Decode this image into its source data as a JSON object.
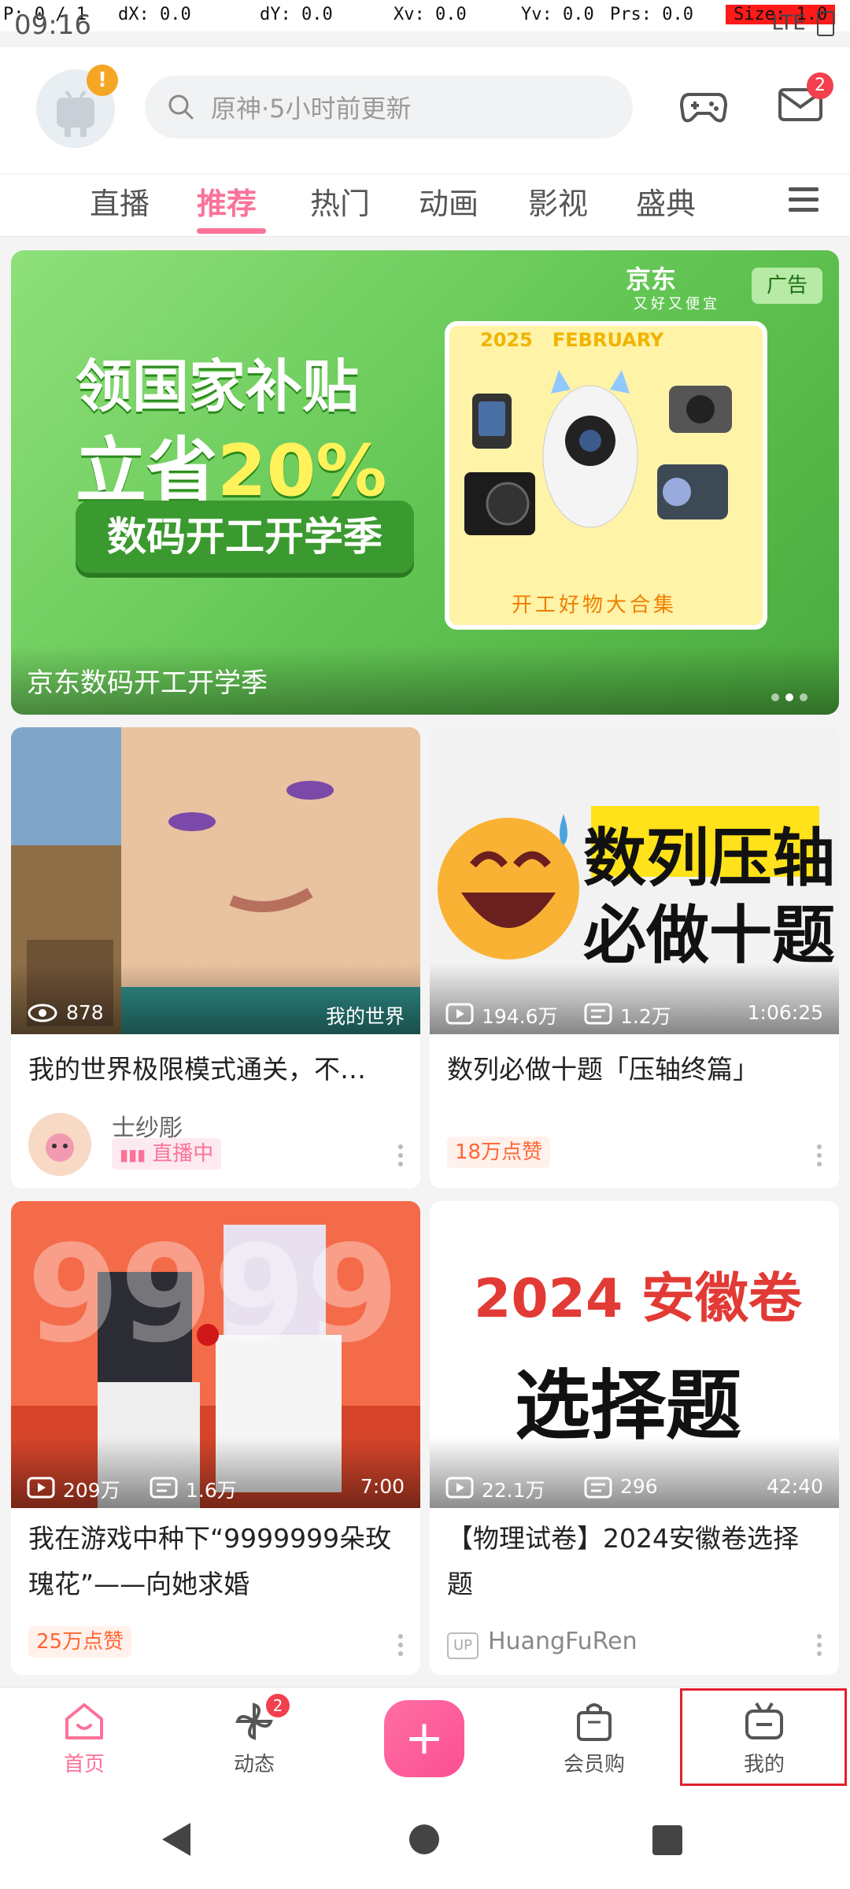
{
  "debug": {
    "pointer": "P: 0 / 1",
    "dx": "dX: 0.0",
    "dy": "dY: 0.0",
    "xv": "Xv: 0.0",
    "yv": "Yv: 0.0",
    "prs": "Prs: 0.0",
    "size": "Size: 1.0"
  },
  "status_bar": {
    "time": "09:16",
    "network": "LTE"
  },
  "header": {
    "search_placeholder": "原神·5小时前更新",
    "avatar_alert": "!",
    "mail_badge": "2"
  },
  "tabs": [
    {
      "label": "直播",
      "active": false
    },
    {
      "label": "推荐",
      "active": true
    },
    {
      "label": "热门",
      "active": false
    },
    {
      "label": "动画",
      "active": false
    },
    {
      "label": "影视",
      "active": false
    },
    {
      "label": "盛典",
      "active": false
    }
  ],
  "banner": {
    "brand": "京东",
    "brand_sub": "又好又便宜",
    "ad_label": "广告",
    "headline1": "领国家补贴",
    "headline2_prefix": "立省",
    "headline2_accent": "20%",
    "pill": "数码开工开学季",
    "box_year": "2025",
    "box_month": "FEBRUARY",
    "box_footer": "开工好物大合集",
    "caption": "京东数码开工开学季",
    "dots": 3,
    "active_dot": 1
  },
  "cards": [
    {
      "views": "878",
      "tag": "我的世界",
      "title": "我的世界极限模式通关，不…",
      "author": "士纱彫",
      "live_label": "直播中"
    },
    {
      "views": "194.6万",
      "danmaku": "1.2万",
      "duration": "1:06:25",
      "thumb_line1": "数列压轴",
      "thumb_line2": "必做十题",
      "title": "数列必做十题「压轴终篇」",
      "badge": "18万点赞"
    },
    {
      "views": "209万",
      "danmaku": "1.6万",
      "duration": "7:00",
      "thumb_text": "9999",
      "title_line1": "我在游戏中种下“9999999朵玫",
      "title_line2": "瑰花”——向她求婚",
      "badge": "25万点赞"
    },
    {
      "views": "22.1万",
      "danmaku": "296",
      "duration": "42:40",
      "thumb_line1": "2024 安徽卷",
      "thumb_line2": "选择题",
      "title_line1": "【物理试卷】2024安徽卷选择",
      "title_line2": "题",
      "up_label": "UP",
      "author": "HuangFuRen"
    }
  ],
  "bottom_nav": {
    "items": [
      {
        "label": "首页",
        "active": true
      },
      {
        "label": "动态",
        "badge": "2"
      },
      {
        "label": "+"
      },
      {
        "label": "会员购"
      },
      {
        "label": "我的"
      }
    ]
  },
  "colors": {
    "accent": "#fb7299",
    "badge_red": "#f2404e",
    "banner_green": "#64c755",
    "like_orange": "#ff6633"
  }
}
